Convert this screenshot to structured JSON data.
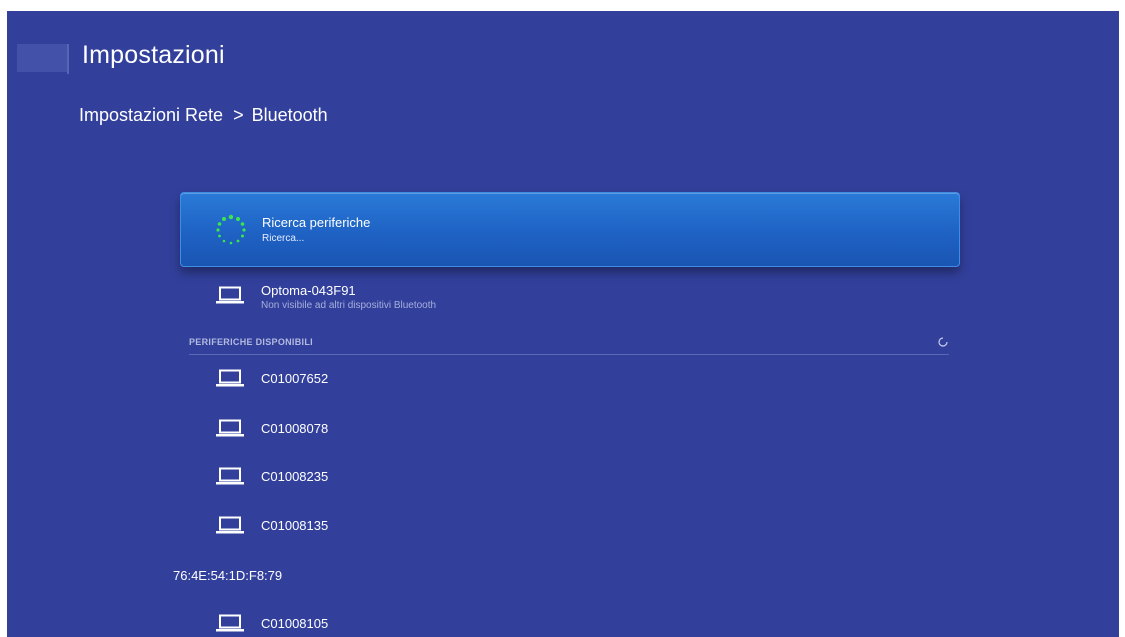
{
  "app": {
    "title": "Impostazioni"
  },
  "breadcrumb": {
    "parent": "Impostazioni Rete",
    "separator": ">",
    "current": "Bluetooth"
  },
  "scan": {
    "title": "Ricerca periferiche",
    "status": "Ricerca...",
    "icon": "loading-spinner-icon"
  },
  "own_device": {
    "name": "Optoma-043F91",
    "visibility": "Non visibile ad altri dispositivi Bluetooth",
    "icon": "laptop-icon"
  },
  "available": {
    "header": "PERIFERICHE DISPONIBILI",
    "refresh_icon": "refresh-icon",
    "devices": [
      {
        "name": "C01007652",
        "icon": "laptop-icon"
      },
      {
        "name": "C01008078",
        "icon": "laptop-icon"
      },
      {
        "name": "C01008235",
        "icon": "laptop-icon"
      },
      {
        "name": "C01008135",
        "icon": "laptop-icon"
      },
      {
        "name": "76:4E:54:1D:F8:79",
        "icon": ""
      },
      {
        "name": "C01008105",
        "icon": "laptop-icon"
      }
    ]
  },
  "colors": {
    "background": "#32409c",
    "highlight": "#2a7ad8",
    "spinner": "#3ce64a"
  }
}
